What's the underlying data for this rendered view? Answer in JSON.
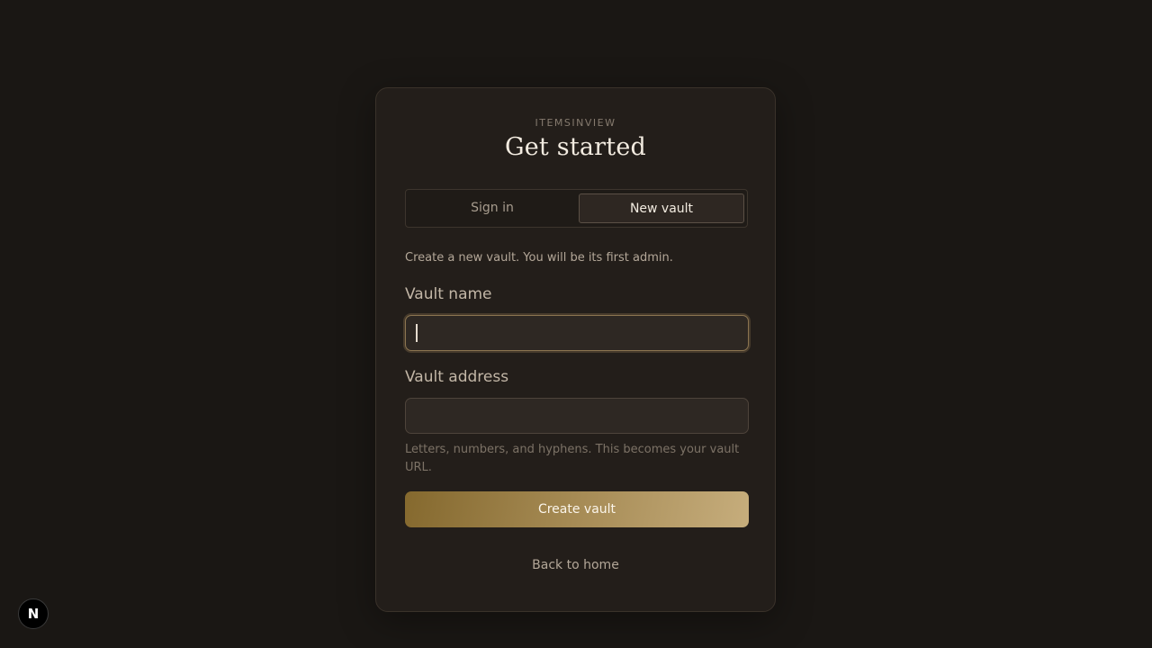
{
  "brand": "ITEMSINVIEW",
  "title": "Get started",
  "tabs": {
    "sign_in": "Sign in",
    "new_vault": "New vault",
    "active": "new_vault"
  },
  "description": "Create a new vault. You will be its first admin.",
  "form": {
    "vault_name_label": "Vault name",
    "vault_name_value": "",
    "vault_address_label": "Vault address",
    "vault_address_value": "",
    "vault_address_hint": "Letters, numbers, and hyphens. This becomes your vault URL.",
    "submit_label": "Create vault"
  },
  "back_link": "Back to home",
  "dev_badge": {
    "label": "N",
    "icon": "nextjs-icon"
  },
  "colors": {
    "background": "#1a1714",
    "card": "#231e1a",
    "accent_start": "#85692e",
    "accent_end": "#c6ad7c",
    "focus_border": "#8b7450"
  }
}
